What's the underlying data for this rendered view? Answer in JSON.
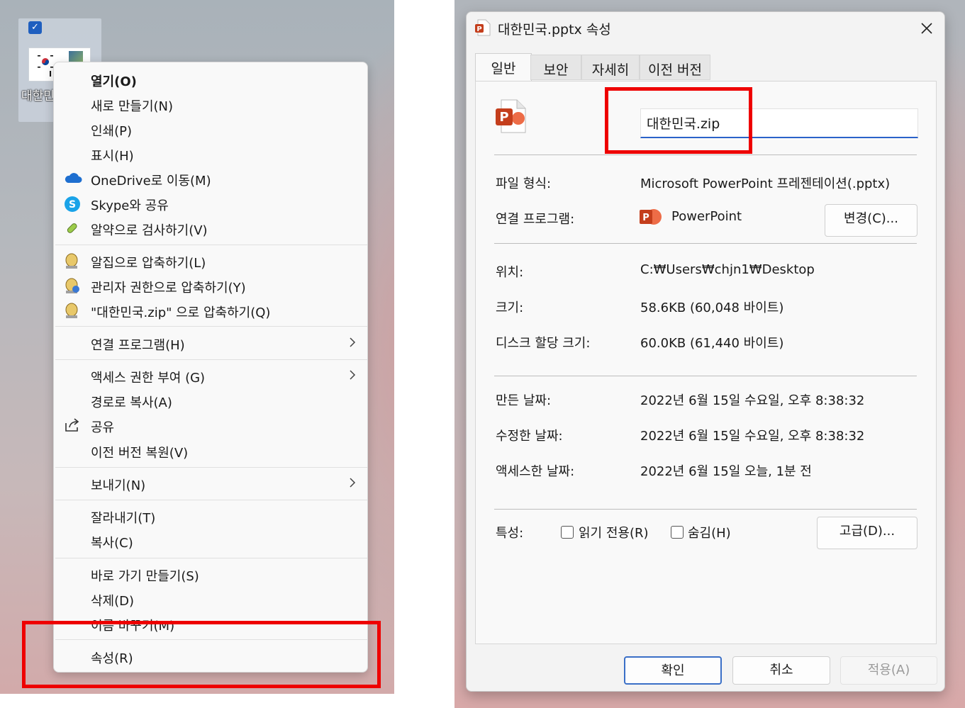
{
  "desktop": {
    "file_label": "대한민",
    "thumb_letter": "I"
  },
  "context_menu": {
    "items": [
      {
        "label": "열기(O)",
        "icon": "none",
        "bold": true
      },
      {
        "label": "새로 만들기(N)",
        "icon": "none"
      },
      {
        "label": "인쇄(P)",
        "icon": "none"
      },
      {
        "label": "표시(H)",
        "icon": "none"
      },
      {
        "label": "OneDrive로 이동(M)",
        "icon": "onedrive-icon"
      },
      {
        "label": "Skype와 공유",
        "icon": "skype-icon"
      },
      {
        "label": "알약으로 검사하기(V)",
        "icon": "alyac-icon"
      },
      {
        "label": "알집으로 압축하기(L)",
        "icon": "alzip-icon"
      },
      {
        "label": "관리자 권한으로 압축하기(Y)",
        "icon": "alzip-admin-icon"
      },
      {
        "label": "\"대한민국.zip\" 으로 압축하기(Q)",
        "icon": "alzip-icon"
      },
      {
        "label": "연결 프로그램(H)",
        "icon": "none",
        "submenu": true
      },
      {
        "label": "액세스 권한 부여 (G)",
        "icon": "none",
        "submenu": true
      },
      {
        "label": "경로로 복사(A)",
        "icon": "none"
      },
      {
        "label": "공유",
        "icon": "share-icon"
      },
      {
        "label": "이전 버전 복원(V)",
        "icon": "none"
      },
      {
        "label": "보내기(N)",
        "icon": "none",
        "submenu": true
      },
      {
        "label": "잘라내기(T)",
        "icon": "none"
      },
      {
        "label": "복사(C)",
        "icon": "none"
      },
      {
        "label": "바로 가기 만들기(S)",
        "icon": "none"
      },
      {
        "label": "삭제(D)",
        "icon": "none"
      },
      {
        "label": "이름 바꾸기(M)",
        "icon": "none"
      },
      {
        "label": "속성(R)",
        "icon": "none"
      }
    ]
  },
  "dialog": {
    "title": "대한민국.pptx 속성",
    "tabs": [
      {
        "label": "일반",
        "active": true
      },
      {
        "label": "보안",
        "active": false
      },
      {
        "label": "자세히",
        "active": false
      },
      {
        "label": "이전 버전",
        "active": false
      }
    ],
    "file_name_value": "대한민국.zip",
    "file_type_label": "파일 형식:",
    "file_type_value": "Microsoft PowerPoint 프레젠테이션(.pptx)",
    "opens_with_label": "연결 프로그램:",
    "opens_with_value": "PowerPoint",
    "change_button": "변경(C)...",
    "location_label": "위치:",
    "location_value": "C:₩Users₩chjn1₩Desktop",
    "size_label": "크기:",
    "size_value": "58.6KB (60,048 바이트)",
    "size_on_disk_label": "디스크 할당 크기:",
    "size_on_disk_value": "60.0KB (61,440 바이트)",
    "created_label": "만든 날짜:",
    "created_value": "2022년 6월 15일 수요일, 오후 8:38:32",
    "modified_label": "수정한 날짜:",
    "modified_value": "2022년 6월 15일 수요일, 오후 8:38:32",
    "accessed_label": "액세스한 날짜:",
    "accessed_value": "2022년 6월 15일 오늘, 1분 전",
    "attributes_label": "특성:",
    "readonly_label": "읽기 전용(R)",
    "readonly_checked": false,
    "hidden_label": "숨김(H)",
    "hidden_checked": false,
    "advanced_button": "고급(D)...",
    "ok_button": "확인",
    "cancel_button": "취소",
    "apply_button": "적용(A)"
  },
  "colors": {
    "highlight_box": "#ee0000",
    "accent": "#2a62c9",
    "powerpoint": "#c43e1c"
  }
}
